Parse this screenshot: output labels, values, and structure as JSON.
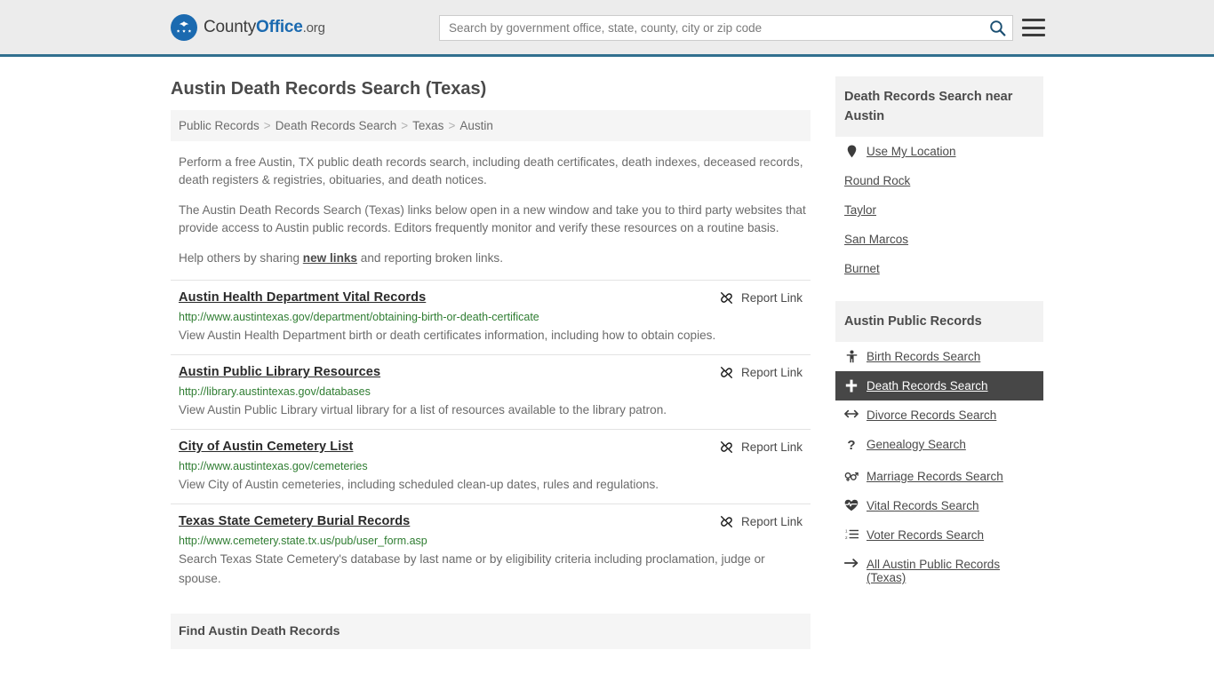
{
  "header": {
    "logo": {
      "county": "County",
      "office": "Office",
      "org": ".org",
      "icon": "eagle-seal-logo"
    },
    "search": {
      "placeholder": "Search by government office, state, county, city or zip code",
      "value": "",
      "button_icon": "search-icon"
    },
    "menu_icon": "hamburger-menu-icon",
    "accent_color": "#31708f"
  },
  "page": {
    "title": "Austin Death Records Search (Texas)",
    "breadcrumb": [
      "Public Records",
      "Death Records Search",
      "Texas",
      "Austin"
    ],
    "breadcrumb_separator": ">",
    "intro": [
      "Perform a free Austin, TX public death records search, including death certificates, death indexes, deceased records, death registers & registries, obituaries, and death notices.",
      "The Austin Death Records Search (Texas) links below open in a new window and take you to third party websites that provide access to Austin public records. Editors frequently monitor and verify these resources on a routine basis."
    ],
    "help_line": {
      "before": "Help others by sharing ",
      "link": "new links",
      "after": " and reporting broken links."
    },
    "find_bar": "Find Austin Death Records"
  },
  "results": {
    "report_label": "Report Link",
    "report_icon": "broken-link-icon",
    "items": [
      {
        "title": "Austin Health Department Vital Records",
        "url": "http://www.austintexas.gov/department/obtaining-birth-or-death-certificate",
        "description": "View Austin Health Department birth or death certificates information, including how to obtain copies."
      },
      {
        "title": "Austin Public Library Resources",
        "url": "http://library.austintexas.gov/databases",
        "description": "View Austin Public Library virtual library for a list of resources available to the library patron."
      },
      {
        "title": "City of Austin Cemetery List",
        "url": "http://www.austintexas.gov/cemeteries",
        "description": "View City of Austin cemeteries, including scheduled clean-up dates, rules and regulations."
      },
      {
        "title": "Texas State Cemetery Burial Records",
        "url": "http://www.cemetery.state.tx.us/pub/user_form.asp",
        "description": "Search Texas State Cemetery's database by last name or by eligibility criteria including proclamation, judge or spouse."
      }
    ]
  },
  "sidebar": {
    "near": {
      "heading": "Death Records Search near Austin",
      "items": [
        {
          "label": "Use My Location",
          "icon": "map-marker-icon"
        },
        {
          "label": "Round Rock",
          "icon": ""
        },
        {
          "label": "Taylor",
          "icon": ""
        },
        {
          "label": "San Marcos",
          "icon": ""
        },
        {
          "label": "Burnet",
          "icon": ""
        }
      ]
    },
    "records": {
      "heading": "Austin Public Records",
      "active_color": "#474747",
      "items": [
        {
          "label": "Birth Records Search",
          "icon": "child-icon",
          "active": false
        },
        {
          "label": "Death Records Search",
          "icon": "plus-cross-icon",
          "active": true
        },
        {
          "label": "Divorce Records Search",
          "icon": "arrows-horizontal-icon",
          "active": false
        },
        {
          "label": "Genealogy Search",
          "icon": "question-mark-icon",
          "active": false
        },
        {
          "label": "Marriage Records Search",
          "icon": "venus-mars-icon",
          "active": false
        },
        {
          "label": "Vital Records Search",
          "icon": "heartbeat-icon",
          "active": false
        },
        {
          "label": "Voter Records Search",
          "icon": "ordered-list-icon",
          "active": false
        },
        {
          "label": "All Austin Public Records (Texas)",
          "icon": "arrow-right-icon",
          "active": false
        }
      ]
    }
  }
}
